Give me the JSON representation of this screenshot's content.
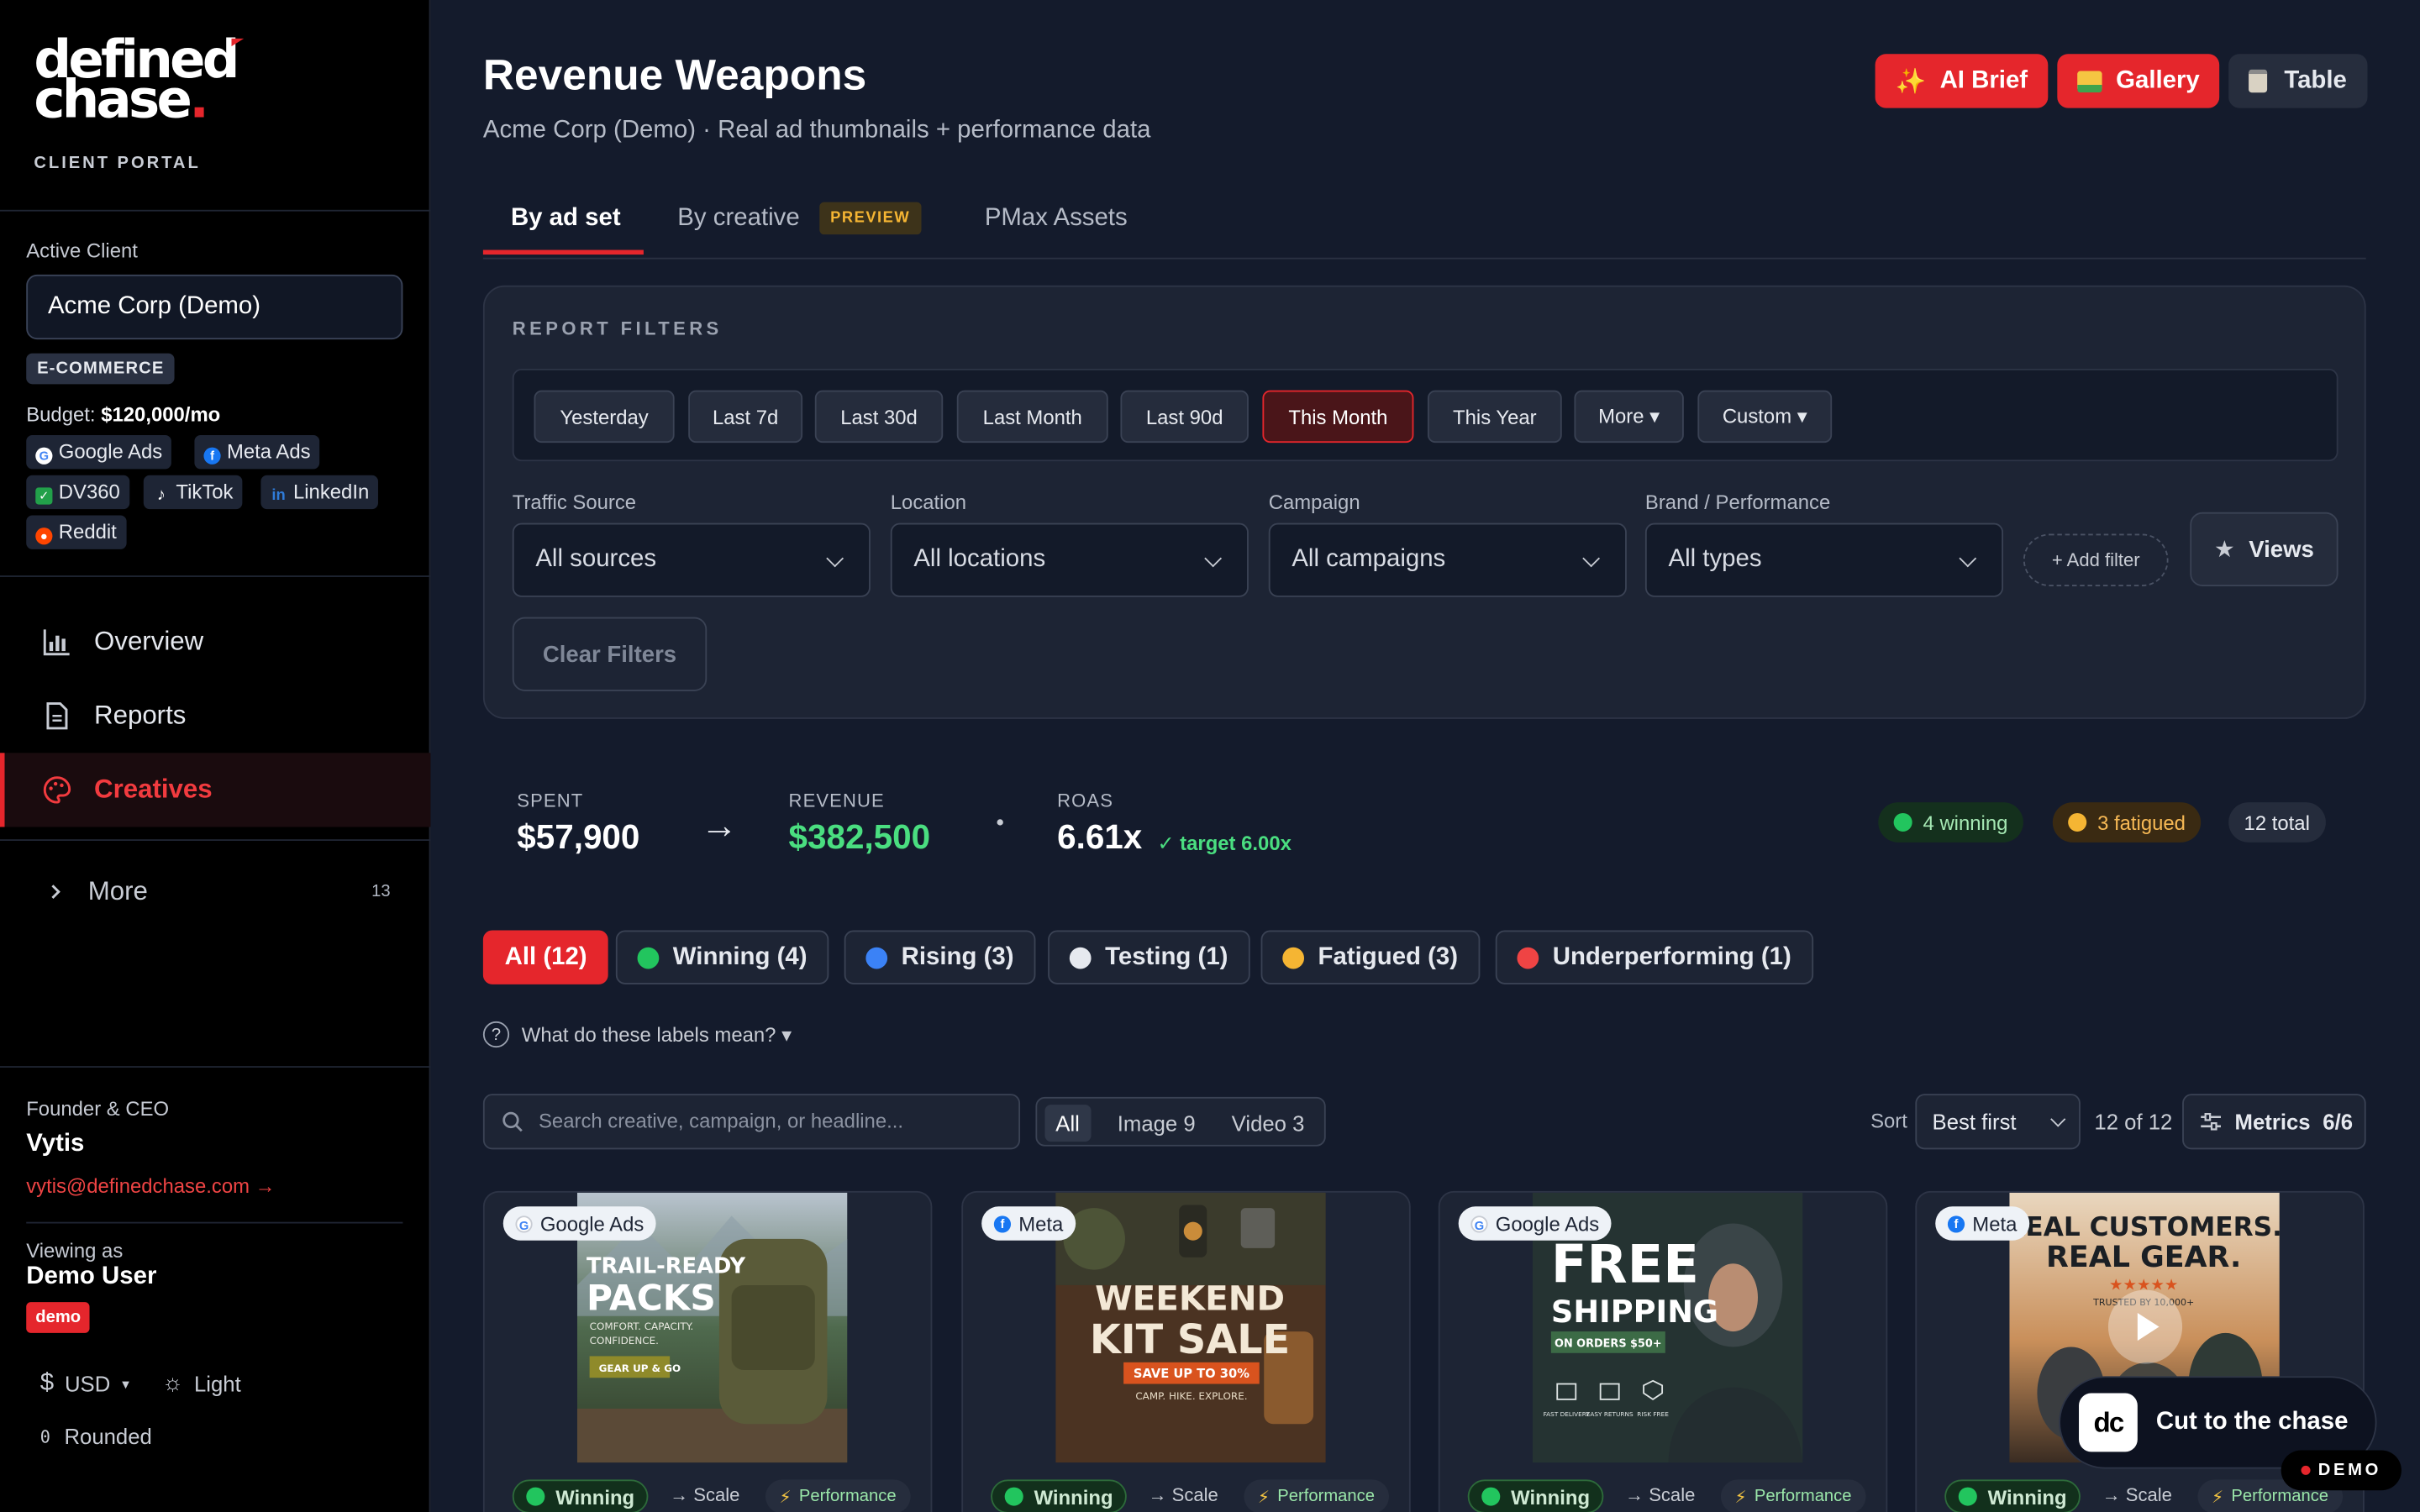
{
  "brand": {
    "word1": "defined",
    "word2": "chase",
    "dot": ".",
    "portal": "CLIENT PORTAL"
  },
  "client": {
    "label": "Active Client",
    "value": "Acme Corp (Demo)",
    "category": "E-COMMERCE",
    "budget_label": "Budget:",
    "budget_value": "$120,000/mo"
  },
  "channels": [
    {
      "name": "Google Ads",
      "icon": "google-icon"
    },
    {
      "name": "Meta Ads",
      "icon": "meta-icon"
    },
    {
      "name": "DV360",
      "icon": "dv360-icon"
    },
    {
      "name": "TikTok",
      "icon": "tiktok-icon"
    },
    {
      "name": "LinkedIn",
      "icon": "linkedin-icon"
    },
    {
      "name": "Reddit",
      "icon": "reddit-icon"
    }
  ],
  "nav": {
    "overview": "Overview",
    "reports": "Reports",
    "creatives": "Creatives",
    "more": "More",
    "more_count": "13"
  },
  "user": {
    "role": "Founder & CEO",
    "name": "Vytis",
    "email": "vytis@definedchase.com →",
    "viewing_label": "Viewing as",
    "viewing_name": "Demo User",
    "badge": "demo",
    "currency": "USD",
    "theme": "Light",
    "corners": "Rounded"
  },
  "page": {
    "title": "Revenue Weapons",
    "subtitle": "Acme Corp (Demo) · Real ad thumbnails + performance data"
  },
  "header_buttons": {
    "ai_brief": "AI Brief",
    "gallery": "Gallery",
    "table": "Table"
  },
  "tabs": {
    "by_ad_set": "By ad set",
    "by_creative": "By creative",
    "preview": "PREVIEW",
    "pmax": "PMax Assets"
  },
  "filters": {
    "title": "REPORT FILTERS",
    "ranges": [
      "Yesterday",
      "Last 7d",
      "Last 30d",
      "Last Month",
      "Last 90d",
      "This Month",
      "This Year",
      "More ▾",
      "Custom ▾"
    ],
    "active_range": "This Month",
    "traffic_label": "Traffic Source",
    "traffic_value": "All sources",
    "location_label": "Location",
    "location_value": "All locations",
    "campaign_label": "Campaign",
    "campaign_value": "All campaigns",
    "brand_label": "Brand / Performance",
    "brand_value": "All types",
    "add_filter": "+ Add filter",
    "views": "Views",
    "clear": "Clear Filters"
  },
  "kpis": {
    "spent_label": "SPENT",
    "spent": "$57,900",
    "revenue_label": "REVENUE",
    "revenue": "$382,500",
    "roas_label": "ROAS",
    "roas": "6.61x",
    "target": "✓ target 6.00x",
    "winning": "4 winning",
    "fatigued": "3 fatigued",
    "total": "12 total"
  },
  "segments": {
    "all": "All (12)",
    "winning": "Winning (4)",
    "rising": "Rising (3)",
    "testing": "Testing (1)",
    "fatigued": "Fatigued (3)",
    "under": "Underperforming (1)"
  },
  "help": "What do these labels mean? ▾",
  "toolbar": {
    "search_placeholder": "Search creative, campaign, or headline...",
    "type_all": "All",
    "type_image": "Image 9",
    "type_video": "Video 3",
    "sort_label": "Sort",
    "sort_value": "Best first",
    "count": "12 of 12",
    "metrics": "Metrics",
    "metrics_count": "6/6"
  },
  "cards": [
    {
      "platform": "Google Ads",
      "l1": "TRAIL-READY",
      "l2": "PACKS",
      "l3": "COMFORT. CAPACITY.",
      "l4": "CONFIDENCE.",
      "l5": "GEAR UP & GO",
      "status": "Winning",
      "action": "→ Scale",
      "type": "Performance"
    },
    {
      "platform": "Meta",
      "l1": "WEEKEND",
      "l2": "KIT SALE",
      "l3": "SAVE UP TO 30%",
      "l4": "CAMP. HIKE. EXPLORE.",
      "status": "Winning",
      "action": "→ Scale",
      "type": "Performance"
    },
    {
      "platform": "Google Ads",
      "l1": "FREE",
      "l2": "SHIPPING",
      "l3": "ON ORDERS $50+",
      "i1": "FAST DELIVERY",
      "i2": "EASY RETURNS",
      "i3": "RISK FREE",
      "status": "Winning",
      "action": "→ Scale",
      "type": "Performance"
    },
    {
      "platform": "Meta",
      "l1": "REAL CUSTOMERS.",
      "l2": "REAL GEAR.",
      "l3": "★★★★★",
      "l4": "TRUSTED BY 10,000+",
      "status": "Winning",
      "action": "→ Scale",
      "type": "Performance"
    }
  ],
  "cta": {
    "logo": "dc",
    "text": "Cut to the chase",
    "demo": "DEMO"
  },
  "colors": {
    "accent": "#e5262c",
    "green": "#4ade80",
    "bg": "#141b2c",
    "panel": "#1d2434"
  }
}
